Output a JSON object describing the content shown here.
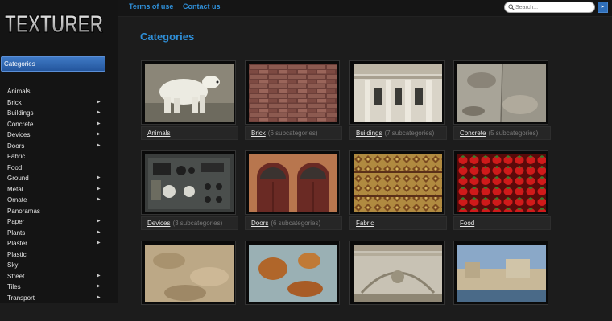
{
  "logo": {
    "text": "TEXTURER"
  },
  "sidebar": {
    "categories_label": "Categories",
    "items": [
      {
        "label": "Animals",
        "arrow": false
      },
      {
        "label": "Brick",
        "arrow": true
      },
      {
        "label": "Buildings",
        "arrow": true
      },
      {
        "label": "Concrete",
        "arrow": true
      },
      {
        "label": "Devices",
        "arrow": true
      },
      {
        "label": "Doors",
        "arrow": true
      },
      {
        "label": "Fabric",
        "arrow": false
      },
      {
        "label": "Food",
        "arrow": false
      },
      {
        "label": "Ground",
        "arrow": true
      },
      {
        "label": "Metal",
        "arrow": true
      },
      {
        "label": "Ornate",
        "arrow": true
      },
      {
        "label": "Panoramas",
        "arrow": false
      },
      {
        "label": "Paper",
        "arrow": true
      },
      {
        "label": "Plants",
        "arrow": true
      },
      {
        "label": "Plaster",
        "arrow": true
      },
      {
        "label": "Plastic",
        "arrow": false
      },
      {
        "label": "Sky",
        "arrow": false
      },
      {
        "label": "Street",
        "arrow": true
      },
      {
        "label": "Tiles",
        "arrow": true
      },
      {
        "label": "Transport",
        "arrow": true
      }
    ]
  },
  "header": {
    "terms": "Terms of use",
    "contact": "Contact us"
  },
  "search": {
    "placeholder": "Search...",
    "go_icon": "triangle-right-icon"
  },
  "main": {
    "title": "Categories",
    "cards": [
      {
        "name": "Animals",
        "sub": ""
      },
      {
        "name": "Brick",
        "sub": "(6 subcategories)"
      },
      {
        "name": "Buildings",
        "sub": "(7 subcategories)"
      },
      {
        "name": "Concrete",
        "sub": "(5 subcategories)"
      },
      {
        "name": "Devices",
        "sub": "(3 subcategories)"
      },
      {
        "name": "Doors",
        "sub": "(6 subcategories)"
      },
      {
        "name": "Fabric",
        "sub": ""
      },
      {
        "name": "Food",
        "sub": ""
      },
      {
        "name": "",
        "sub": ""
      },
      {
        "name": "",
        "sub": ""
      },
      {
        "name": "",
        "sub": ""
      },
      {
        "name": "",
        "sub": ""
      }
    ]
  },
  "colors": {
    "accent": "#2f8fd8",
    "button": "#2f6fba",
    "background": "#1c1c1c"
  }
}
